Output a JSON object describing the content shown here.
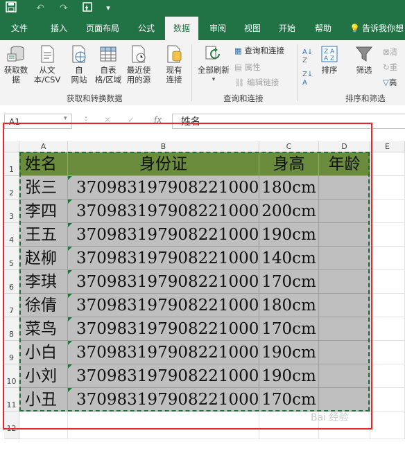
{
  "quick_access": {
    "save_icon": "save-icon",
    "undo_icon": "undo-icon",
    "redo_icon": "redo-icon",
    "touch_icon": "touch-mode-icon",
    "customize_icon": "customize-dropdown-icon"
  },
  "tabs": [
    "文件",
    "插入",
    "页面布局",
    "公式",
    "数据",
    "审阅",
    "视图",
    "开始",
    "帮助",
    "告诉我你想"
  ],
  "active_tab": "数据",
  "ribbon": {
    "get_data": "获取数\n据",
    "from_csv": "从文\n本/CSV",
    "from_web": "自\n网站",
    "from_table": "自表\n格/区域",
    "recent_sources": "最近使\n用的源",
    "existing_connections": "现有\n连接",
    "group_get_transform": "获取和转换数据",
    "refresh_all": "全部刷新",
    "queries_connections": "查询和连接",
    "properties": "属性",
    "edit_links": "编辑链接",
    "group_queries": "查询和连接",
    "sort": "排序",
    "filter": "筛选",
    "clear": "清",
    "reapply": "重",
    "advanced": "高",
    "group_sort_filter": "排序和筛选"
  },
  "formula_bar": {
    "name_box": "A1",
    "content": "姓名",
    "fx_symbol": "fx"
  },
  "sheet": {
    "columns": [
      "A",
      "B",
      "C",
      "D",
      "E"
    ],
    "rows": [
      "1",
      "2",
      "3",
      "4",
      "5",
      "6",
      "7",
      "8",
      "9",
      "10",
      "11",
      "12"
    ],
    "header": [
      "姓名",
      "身份证",
      "身高",
      "年龄"
    ],
    "data": [
      [
        "张三",
        "370983197908221000",
        "180cm",
        ""
      ],
      [
        "李四",
        "370983197908221000",
        "200cm",
        ""
      ],
      [
        "王五",
        "370983197908221000",
        "190cm",
        ""
      ],
      [
        "赵柳",
        "370983197908221000",
        "140cm",
        ""
      ],
      [
        "李琪",
        "370983197908221000",
        "170cm",
        ""
      ],
      [
        "徐倩",
        "370983197908221000",
        "180cm",
        ""
      ],
      [
        "菜鸟",
        "370983197908221000",
        "170cm",
        ""
      ],
      [
        "小白",
        "370983197908221000",
        "190cm",
        ""
      ],
      [
        "小刘",
        "370983197908221000",
        "190cm",
        ""
      ],
      [
        "小丑",
        "370983197908221000",
        "170cm",
        ""
      ]
    ]
  },
  "colors": {
    "excel_green": "#217346",
    "header_fill": "#6b8b3d",
    "body_fill": "#bfbfbf",
    "highlight_border": "#e8262a"
  }
}
